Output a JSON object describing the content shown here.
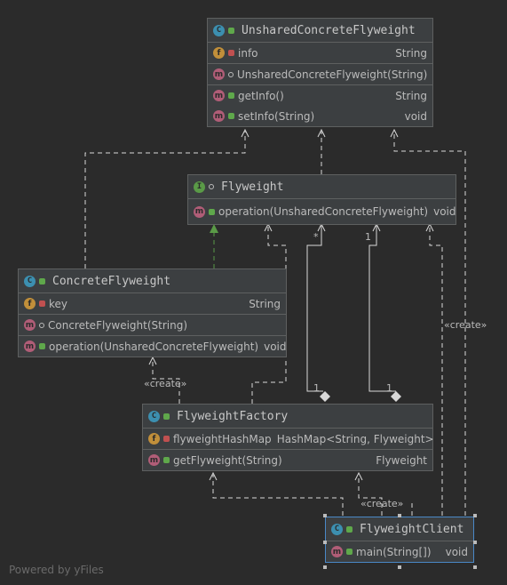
{
  "classes": {
    "unshared": {
      "name": "UnsharedConcreteFlyweight",
      "fields": [
        {
          "name": "info",
          "type": "String"
        }
      ],
      "constructors": [
        {
          "name": "UnsharedConcreteFlyweight(String)",
          "type": ""
        }
      ],
      "methods": [
        {
          "name": "getInfo()",
          "type": "String"
        },
        {
          "name": "setInfo(String)",
          "type": "void"
        }
      ]
    },
    "flyweight": {
      "name": "Flyweight",
      "methods": [
        {
          "name": "operation(UnsharedConcreteFlyweight)",
          "type": "void"
        }
      ]
    },
    "concrete": {
      "name": "ConcreteFlyweight",
      "fields": [
        {
          "name": "key",
          "type": "String"
        }
      ],
      "constructors": [
        {
          "name": "ConcreteFlyweight(String)",
          "type": ""
        }
      ],
      "methods": [
        {
          "name": "operation(UnsharedConcreteFlyweight)",
          "type": "void"
        }
      ]
    },
    "factory": {
      "name": "FlyweightFactory",
      "fields": [
        {
          "name": "flyweightHashMap",
          "type": "HashMap<String, Flyweight>"
        }
      ],
      "methods": [
        {
          "name": "getFlyweight(String)",
          "type": "Flyweight"
        }
      ]
    },
    "client": {
      "name": "FlyweightClient",
      "methods": [
        {
          "name": "main(String[])",
          "type": "void"
        }
      ]
    }
  },
  "edge_labels": {
    "create_concrete": "«create»",
    "create_unshared": "«create»",
    "create_factory": "«create»",
    "mult_star": "*",
    "mult_one_top": "1",
    "mult_one_a": "1",
    "mult_one_b": "1"
  },
  "icons": {
    "class": "C",
    "interface": "I",
    "field": "f",
    "method": "m"
  },
  "colors": {
    "background": "#2b2b2b",
    "box": "#3c3f41",
    "line": "#d8d8d8",
    "realization": "#5a9a47",
    "selected": "#4a88c7"
  },
  "footer": "Powered by yFiles"
}
